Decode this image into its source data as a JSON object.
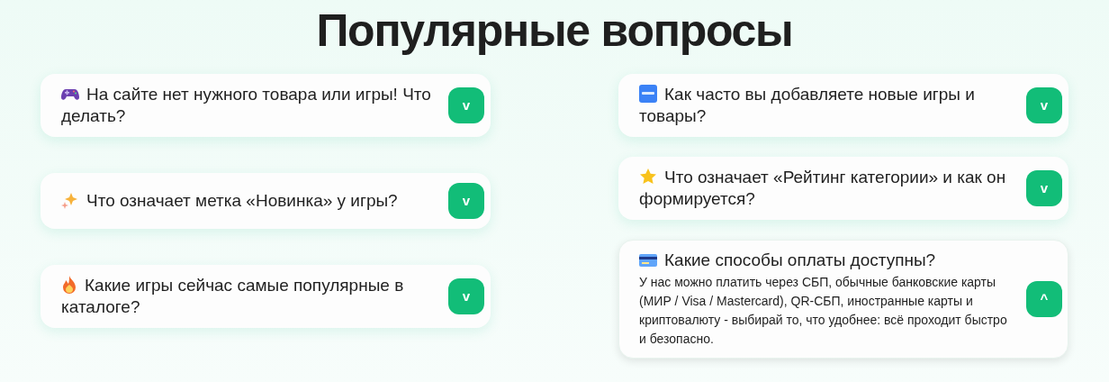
{
  "title": "Популярные вопросы",
  "columns": [
    {
      "items": [
        {
          "question": "На сайте нет нужного товара или игры! Что делать?",
          "expanded": false,
          "toggle": "v"
        },
        {
          "question": "Что означает метка «Новинка» у игры?",
          "expanded": false,
          "toggle": "v"
        },
        {
          "question": "Какие игры сейчас самые популярные в каталоге?",
          "expanded": false,
          "toggle": "v"
        }
      ]
    },
    {
      "items": [
        {
          "question": "Как часто вы добавляете новые игры и товары?",
          "expanded": false,
          "toggle": "v"
        },
        {
          "question": "Что означает «Рейтинг категории» и как он формируется?",
          "expanded": false,
          "toggle": "v"
        },
        {
          "question": "Какие способы оплаты доступны?",
          "expanded": true,
          "toggle": "^",
          "answer": "У нас можно платить через СБП, обычные банковские карты (МИР / Visa / Mastercard), QR-СБП, иностранные карты и криптовалюту - выбирай то, что удобнее: всё проходит быстро и безопасно."
        }
      ]
    }
  ]
}
